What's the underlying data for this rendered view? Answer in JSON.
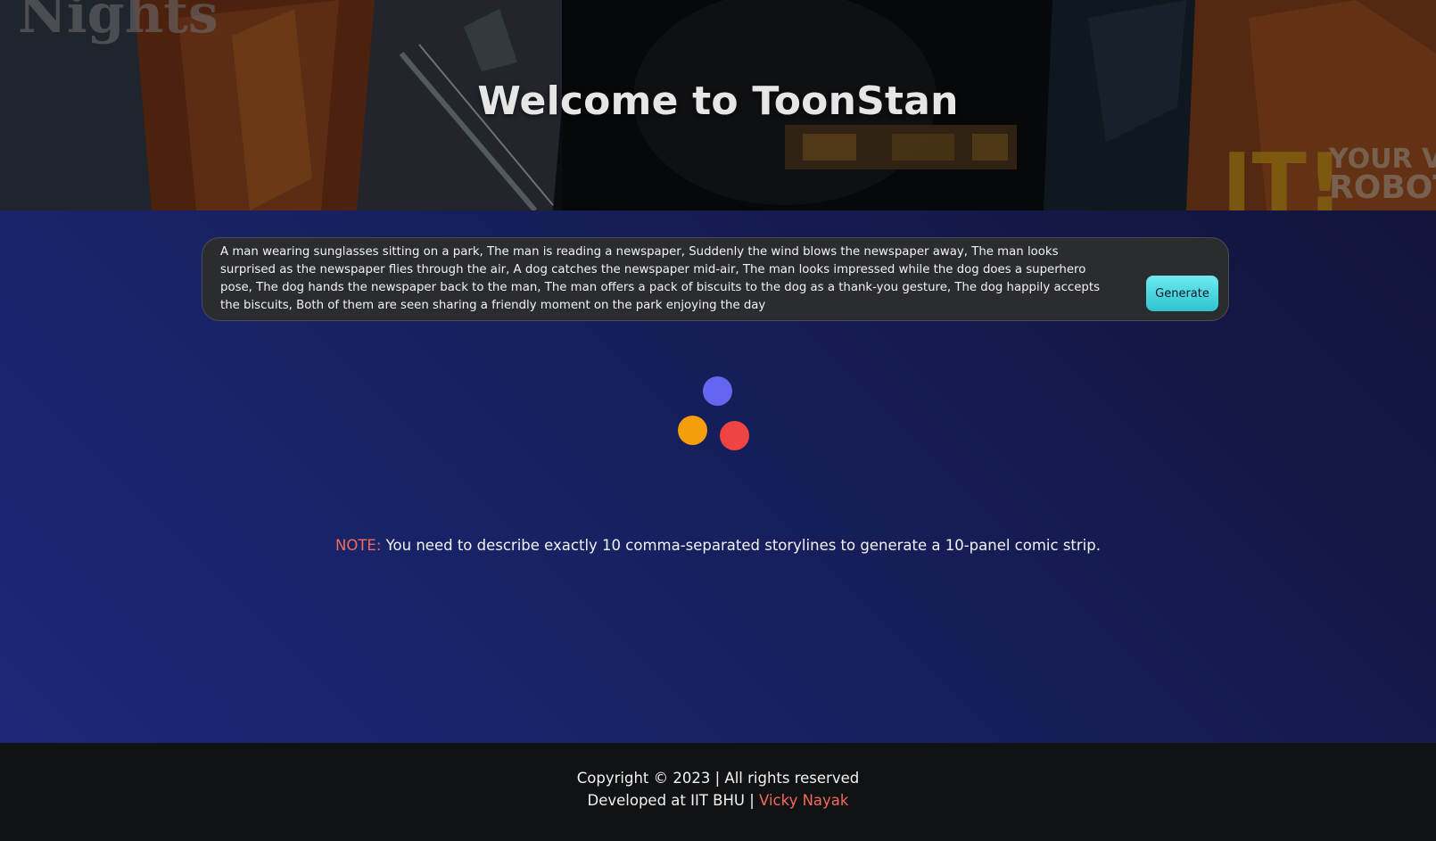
{
  "hero": {
    "title": "Welcome to ToonStan"
  },
  "prompt": {
    "value": "A man wearing sunglasses sitting on a park, The man is reading a newspaper, Suddenly the wind blows the newspaper away, The man looks surprised as the newspaper flies through the air, A dog catches the newspaper mid-air, The man looks impressed while the dog does a superhero pose, The dog hands the newspaper back to the man, The man offers a pack of biscuits to the dog as a thank-you gesture, The dog happily accepts the biscuits, Both of them are seen sharing a friendly moment on the park enjoying the day",
    "generate_label": "Generate"
  },
  "loader": {
    "colors": {
      "blue": "#6466f1",
      "orange": "#f59e0b",
      "red": "#ef4444"
    }
  },
  "note": {
    "label": "NOTE:",
    "text": " You need to describe exactly 10 comma-separated storylines to generate a 10-panel comic strip."
  },
  "footer": {
    "copyright": "Copyright © 2023 | All rights reserved",
    "developed_prefix": "Developed at IIT BHU | ",
    "developer_name": "Vicky Nayak"
  },
  "colors": {
    "accent": "#f26b5b",
    "button": "#3fd3dc",
    "footer_bg": "#111214",
    "main_bg": "#1a2467"
  }
}
